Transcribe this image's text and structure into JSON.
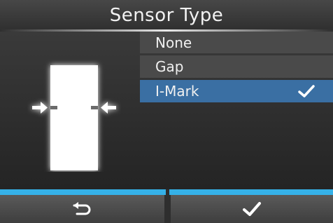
{
  "screen": {
    "title": "Sensor Type"
  },
  "options": [
    {
      "label": "None",
      "selected": false
    },
    {
      "label": "Gap",
      "selected": false
    },
    {
      "label": "I-Mark",
      "selected": true
    }
  ],
  "footer": {
    "back_icon": "return-arrow-icon",
    "confirm_icon": "checkmark-icon"
  },
  "colors": {
    "accent": "#35b1e8",
    "selected_row": "#3a6fa3"
  }
}
